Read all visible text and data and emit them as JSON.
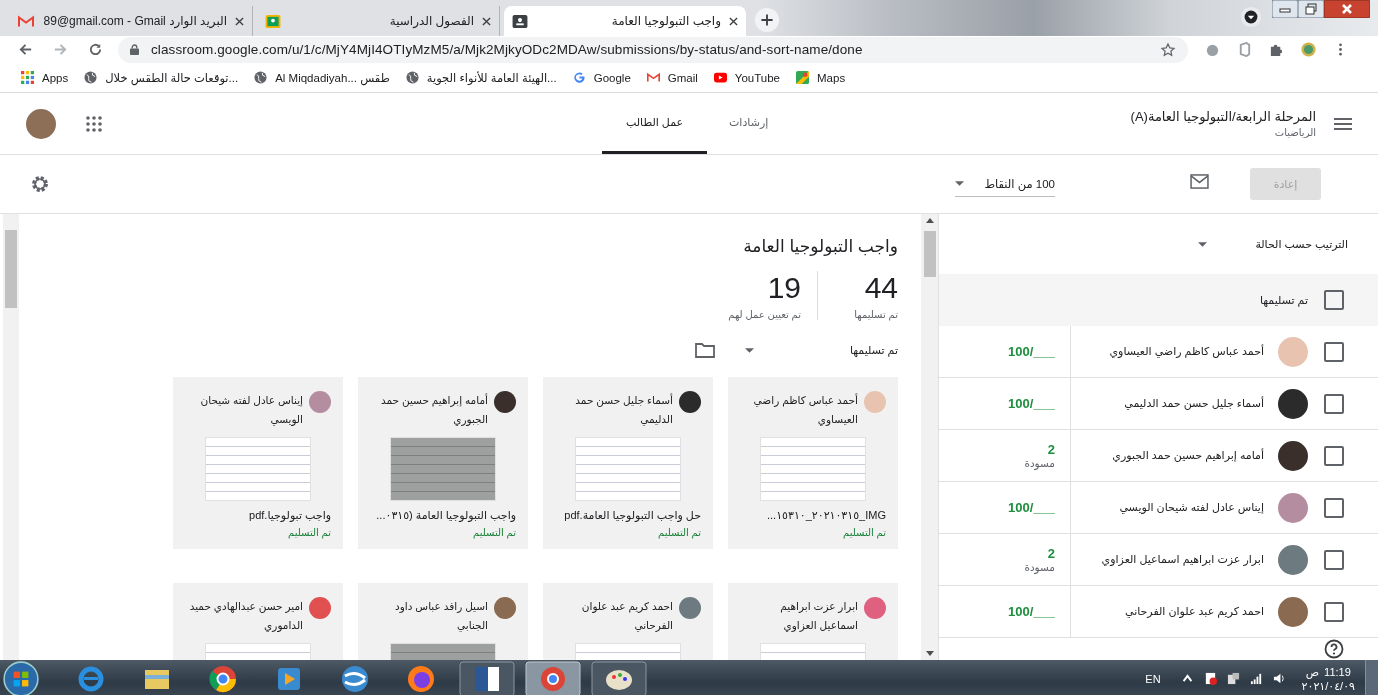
{
  "browser_tabs": [
    {
      "kind": "assignment",
      "title": "واجب التبولوجيا العامة",
      "selected": true
    },
    {
      "kind": "classroom",
      "title": "الفصول الدراسية",
      "selected": false
    },
    {
      "kind": "mail",
      "title": "89@gmail.com - Gmail البريد الوارد",
      "selected": false
    }
  ],
  "address_bar": {
    "url": "classroom.google.com/u/1/c/MjY4MjI4OTIyMzM5/a/Mjk2MjkyODc2MDAw/submissions/by-status/and-sort-name/done"
  },
  "bookmarks": [
    {
      "kind": "maps",
      "label": "Maps"
    },
    {
      "kind": "video",
      "label": "YouTube"
    },
    {
      "kind": "mail",
      "label": "Gmail"
    },
    {
      "kind": "google",
      "label": "Google"
    },
    {
      "kind": "globe",
      "label": "الهيئة العامة للأنواء الجوية..."
    },
    {
      "kind": "globe",
      "label": "Al Miqdadiyah... طقس"
    },
    {
      "kind": "globe",
      "label": "توقعات حالة الطقس خلال..."
    },
    {
      "kind": "apps",
      "label": "Apps"
    }
  ],
  "class_header": {
    "title": "المرحلة الرابعة/التبولوجيا العامة(A)",
    "subtitle": "الرياضيات",
    "tabs": [
      {
        "label": "إرشادات",
        "selected": false
      },
      {
        "label": "عمل الطالب",
        "selected": true
      }
    ]
  },
  "action_bar": {
    "points": "100 من النقاط",
    "return_button": {
      "label": "إعادة",
      "disabled": true
    }
  },
  "assignment": {
    "title": "واجب التبولوجيا العامة",
    "stats": [
      {
        "value": "44",
        "label": "تم تسليمها"
      },
      {
        "value": "19",
        "label": "تم تعيين عمل لهم"
      }
    ],
    "filter": "تم تسليمها",
    "cards": [
      {
        "name": "أحمد عباس كاظم راضي العيساوي",
        "file": "IMG_٢٠٢١٠٣١٥_١٥٣١٠...",
        "status": "تم التسليم"
      },
      {
        "name": "أسماء جليل حسن حمد الدليمي",
        "file": "حل واجب التبولوجيا العامة.pdf",
        "status": "تم التسليم"
      },
      {
        "name": "أمامه إبراهيم حسين حمد الجبوري",
        "file": "واجب التبولوجيا العامة (٠٣١٥...",
        "status": "تم التسليم"
      },
      {
        "name": "إيناس عادل لفته شيحان الويسي",
        "file": "واجب تبولوجيا.pdf",
        "status": "تم التسليم"
      },
      {
        "name": "ابرار عزت ابراهيم اسماعيل العزاوي"
      },
      {
        "name": "احمد كريم عبد علوان الفرحاني"
      },
      {
        "name": "اسيل رافد عباس داود الجنابي"
      },
      {
        "name": "امير حسن عبدالهادي حميد الداموري"
      }
    ]
  },
  "student_list": {
    "sort": "الترتيب حسب الحالة",
    "group": {
      "label": "تم تسليمها",
      "checked": false
    },
    "rows": [
      {
        "name": "أحمد عباس كاظم راضي العيساوي",
        "checked": false,
        "kind": "ungraded",
        "grade": "100/___"
      },
      {
        "name": "أسماء جليل حسن حمد الدليمي",
        "checked": false,
        "kind": "ungraded",
        "grade": "100/___"
      },
      {
        "name": "أمامه إبراهيم حسين حمد الجبوري",
        "checked": false,
        "kind": "draft",
        "grade": "2",
        "note": "مسودة"
      },
      {
        "name": "إيناس عادل لفته شيحان الويسي",
        "checked": false,
        "kind": "ungraded",
        "grade": "100/___"
      },
      {
        "name": "ابرار عزت ابراهيم اسماعيل العزاوي",
        "checked": false,
        "kind": "draft",
        "grade": "2",
        "note": "مسودة"
      },
      {
        "name": "احمد كريم عبد علوان الفرحاني",
        "checked": false,
        "kind": "ungraded",
        "grade": "100/___"
      }
    ]
  },
  "taskbar": {
    "language": "EN",
    "time": "11:19",
    "period": "ص",
    "date": "٢٠٢١/٠٤/٠٩"
  }
}
